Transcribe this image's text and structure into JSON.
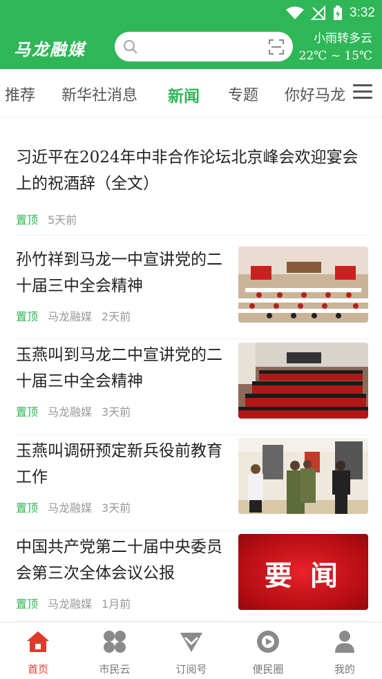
{
  "status": {
    "time": "3:32"
  },
  "header": {
    "logo": "马龙融媒",
    "weather_desc": "小雨转多云",
    "weather_temp": "22℃ ~ 15℃"
  },
  "search": {
    "placeholder": ""
  },
  "tabs": [
    {
      "label": "推荐"
    },
    {
      "label": "新华社消息"
    },
    {
      "label": "新闻"
    },
    {
      "label": "专题"
    },
    {
      "label": "你好马龙"
    }
  ],
  "news": [
    {
      "title": "习近平在2024年中非合作论坛北京峰会欢迎宴会上的祝酒辞（全文）",
      "pin": "置顶",
      "source": "",
      "time": "5天前"
    },
    {
      "title": "孙竹祥到马龙一中宣讲党的二十届三中全会精神",
      "pin": "置顶",
      "source": "马龙融媒",
      "time": "2天前"
    },
    {
      "title": "玉燕叫到马龙二中宣讲党的二十届三中全会精神",
      "pin": "置顶",
      "source": "马龙融媒",
      "time": "3天前"
    },
    {
      "title": "玉燕叫调研预定新兵役前教育工作",
      "pin": "置顶",
      "source": "马龙融媒",
      "time": "3天前"
    },
    {
      "title": "中国共产党第二十届中央委员会第三次全体会议公报",
      "pin": "置顶",
      "source": "马龙融媒",
      "time": "1月前",
      "thumb_text": "要 闻"
    }
  ],
  "bottom_nav": [
    {
      "label": "首页",
      "icon": "home-icon"
    },
    {
      "label": "市民云",
      "icon": "clover-icon"
    },
    {
      "label": "订阅号",
      "icon": "diamond-icon"
    },
    {
      "label": "便民圈",
      "icon": "circle-play-icon"
    },
    {
      "label": "我的",
      "icon": "user-icon"
    }
  ],
  "colors": {
    "brand": "#2fb657",
    "active_nav": "#e03a2a"
  }
}
